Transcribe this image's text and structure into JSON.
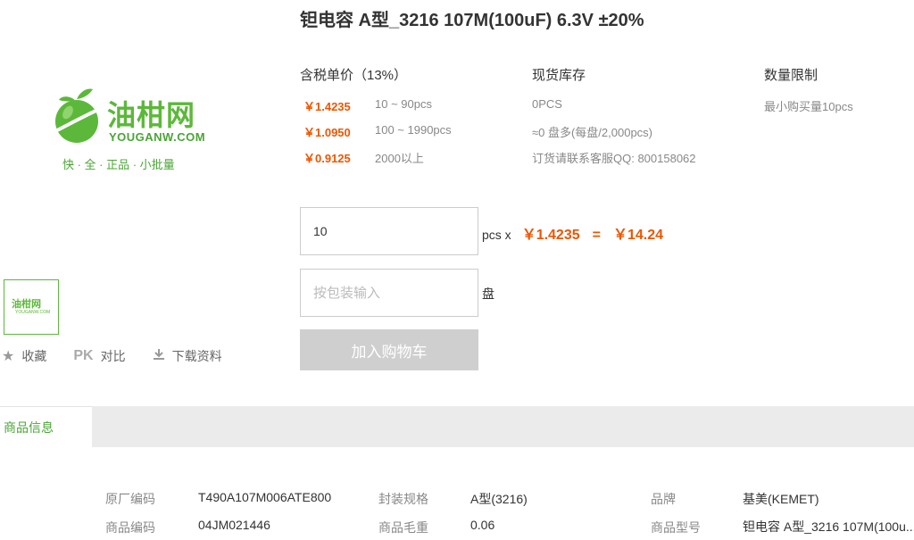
{
  "product": {
    "title": "钽电容 A型_3216 107M(100uF) 6.3V ±20%"
  },
  "logo": {
    "name": "油柑网",
    "domain": "YOUGANW.COM",
    "slogan": "快 · 全 · 正品 · 小批量",
    "color": "#5cb83a"
  },
  "actions": {
    "favorite_label": "收藏",
    "compare_badge": "PK",
    "compare_label": "对比",
    "download_label": "下载资料"
  },
  "pricing": {
    "header": "含税单价（13%）",
    "tiers": [
      {
        "price": "￥1.4235",
        "range": "10 ~ 90pcs"
      },
      {
        "price": "￥1.0950",
        "range": "100 ~ 1990pcs"
      },
      {
        "price": "￥0.9125",
        "range": "2000以上"
      }
    ]
  },
  "stock": {
    "header": "现货库存",
    "lines": [
      "0PCS",
      "≈0 盘多(每盘/2,000pcs)",
      "订货请联系客服QQ: 800158062"
    ]
  },
  "limit": {
    "header": "数量限制",
    "text": "最小购买量10pcs"
  },
  "order": {
    "quantity_value": "10",
    "unit_label": "pcs x",
    "unit_price": "￥1.4235",
    "equals": "=",
    "total": "￥14.24",
    "pack_placeholder": "按包装输入",
    "pack_unit": "盘",
    "cart_button": "加入购物车"
  },
  "tabs": {
    "active": "商品信息"
  },
  "specs": [
    {
      "label": "原厂编码",
      "value": "T490A107M006ATE800"
    },
    {
      "label": "封装规格",
      "value": "A型(3216)"
    },
    {
      "label": "品牌",
      "value": "基美(KEMET)"
    },
    {
      "label": "商品编码",
      "value": "04JM021446"
    },
    {
      "label": "商品毛重",
      "value": "0.06"
    },
    {
      "label": "商品型号",
      "value": "钽电容 A型_3216 107M(100u..."
    }
  ],
  "colors": {
    "accent_orange": "#ee5500",
    "brand_green": "#5cb83a",
    "tab_bar_gray": "#ebebeb",
    "button_disabled": "#cfcfcf"
  }
}
